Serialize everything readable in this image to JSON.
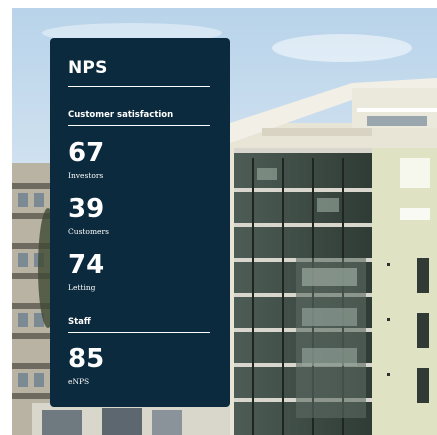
{
  "card": {
    "title": "NPS",
    "section_customer": "Customer satisfaction",
    "section_staff": "Staff",
    "stats": [
      {
        "value": "67",
        "label": "Investors"
      },
      {
        "value": "39",
        "label": "Customers"
      },
      {
        "value": "74",
        "label": "Letting"
      },
      {
        "value": "85",
        "label": "eNPS"
      }
    ]
  },
  "colors": {
    "card_background": "#0b2a3d",
    "text": "#ffffff",
    "sky": "#cfe0ef",
    "building": "#e9e5d6",
    "balcony_glass": "#3e4e46"
  },
  "photo": {
    "subject": "apartment-building-with-glass-balconies"
  }
}
